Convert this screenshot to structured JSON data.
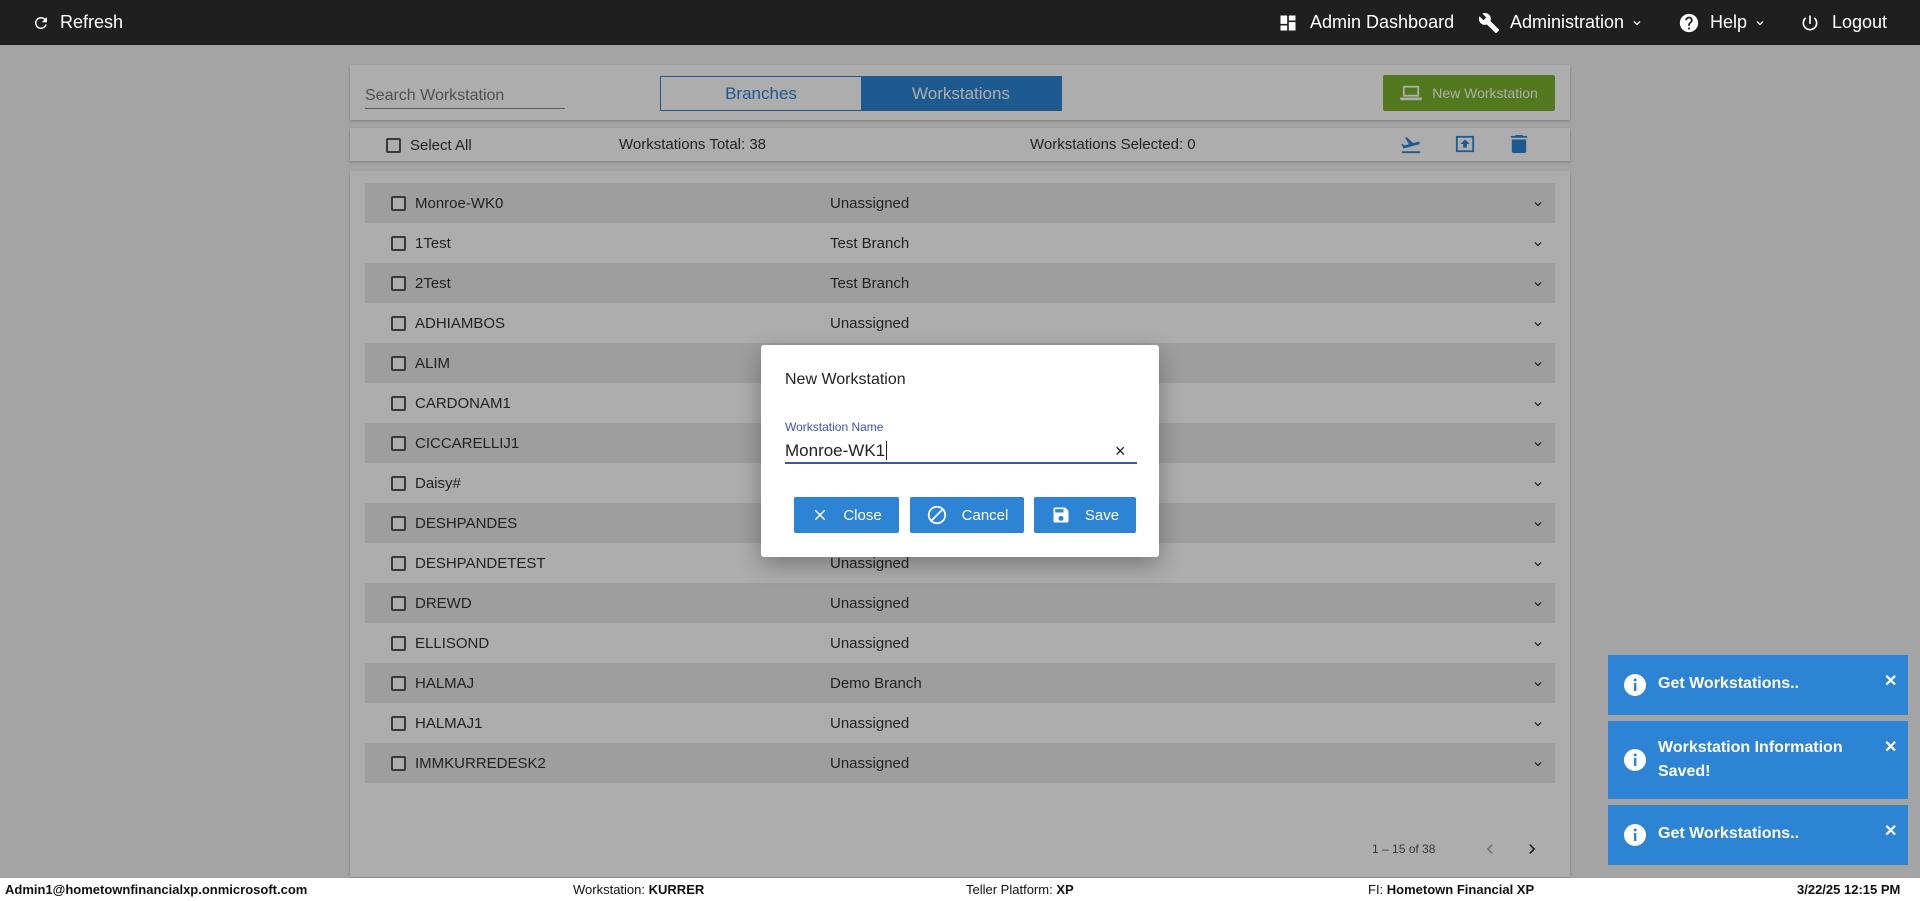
{
  "topbar": {
    "refresh": "Refresh",
    "admin_dashboard": "Admin Dashboard",
    "administration": "Administration",
    "help": "Help",
    "logout": "Logout"
  },
  "toolbar": {
    "search_placeholder": "Search Workstation",
    "tab_branches": "Branches",
    "tab_workstations": "Workstations",
    "active_tab": "Workstations",
    "new_button": "New Workstation"
  },
  "stats": {
    "select_all": "Select All",
    "total": "Workstations Total: 38",
    "selected": "Workstations Selected: 0"
  },
  "list": {
    "rows": [
      {
        "name": "Monroe-WK0",
        "branch": "Unassigned"
      },
      {
        "name": "1Test",
        "branch": "Test Branch"
      },
      {
        "name": "2Test",
        "branch": "Test Branch"
      },
      {
        "name": "ADHIAMBOS",
        "branch": "Unassigned"
      },
      {
        "name": "ALIM",
        "branch": ""
      },
      {
        "name": "CARDONAM1",
        "branch": ""
      },
      {
        "name": "CICCARELLIJ1",
        "branch": ""
      },
      {
        "name": "Daisy#",
        "branch": ""
      },
      {
        "name": "DESHPANDES",
        "branch": ""
      },
      {
        "name": "DESHPANDETEST",
        "branch": "Unassigned"
      },
      {
        "name": "DREWD",
        "branch": "Unassigned"
      },
      {
        "name": "ELLISOND",
        "branch": "Unassigned"
      },
      {
        "name": "HALMAJ",
        "branch": "Demo Branch"
      },
      {
        "name": "HALMAJ1",
        "branch": "Unassigned"
      },
      {
        "name": "IMMKURREDESK2",
        "branch": "Unassigned"
      }
    ],
    "pager": "1 – 15 of 38"
  },
  "dialog": {
    "title": "New Workstation",
    "field_label": "Workstation Name",
    "field_value": "Monroe-WK1",
    "close": "Close",
    "cancel": "Cancel",
    "save": "Save"
  },
  "toasts": [
    "Get Workstations..",
    "Workstation Information Saved!",
    "Get Workstations.."
  ],
  "footer": {
    "user": "Admin1@hometownfinancialxp.onmicrosoft.com",
    "workstation_label": "Workstation:",
    "workstation_value": "KURRER",
    "platform_label": "Teller Platform:",
    "platform_value": "XP",
    "fi_label": "FI:",
    "fi_value": "Hometown Financial XP",
    "datetime": "3/22/25 12:15 PM"
  },
  "colors": {
    "accent": "#2d84d4",
    "new_button": "#7ab32c",
    "topbar": "#1f1f1f",
    "dialog_focus": "#3f51b5"
  }
}
